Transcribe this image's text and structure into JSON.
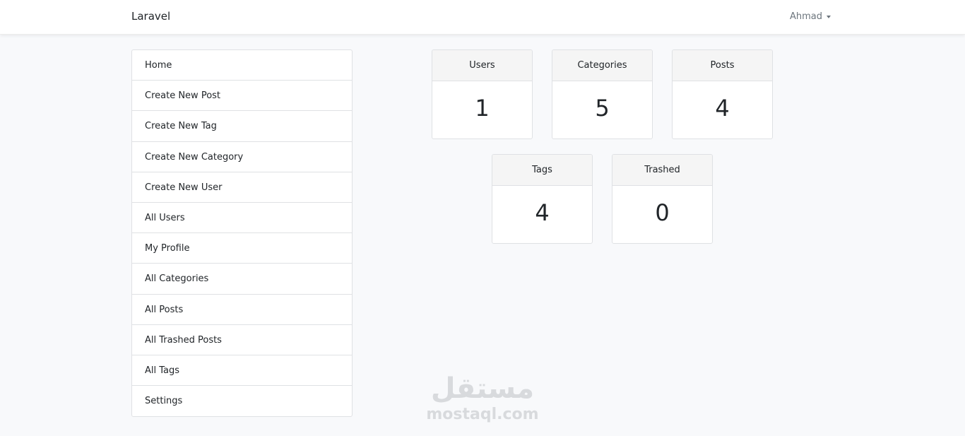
{
  "navbar": {
    "brand": "Laravel",
    "user_name": "Ahmad",
    "user_menu_icon": "caret-down-icon"
  },
  "sidebar": {
    "items": [
      {
        "label": "Home"
      },
      {
        "label": "Create New Post"
      },
      {
        "label": "Create New Tag"
      },
      {
        "label": "Create New Category"
      },
      {
        "label": "Create New User"
      },
      {
        "label": "All Users"
      },
      {
        "label": "My Profile"
      },
      {
        "label": "All Categories"
      },
      {
        "label": "All Posts"
      },
      {
        "label": "All Trashed Posts"
      },
      {
        "label": "All Tags"
      },
      {
        "label": "Settings"
      }
    ]
  },
  "stats": [
    {
      "title": "Users",
      "count": "1"
    },
    {
      "title": "Categories",
      "count": "5"
    },
    {
      "title": "Posts",
      "count": "4"
    },
    {
      "title": "Tags",
      "count": "4"
    },
    {
      "title": "Trashed",
      "count": "0"
    }
  ],
  "watermark": {
    "arabic": "مستقل",
    "latin": "mostaql.com"
  },
  "colors": {
    "background": "#f8f9fb",
    "card_header": "#f5f5f5",
    "border": "#dfe1e4",
    "muted_text": "#6c757d"
  }
}
